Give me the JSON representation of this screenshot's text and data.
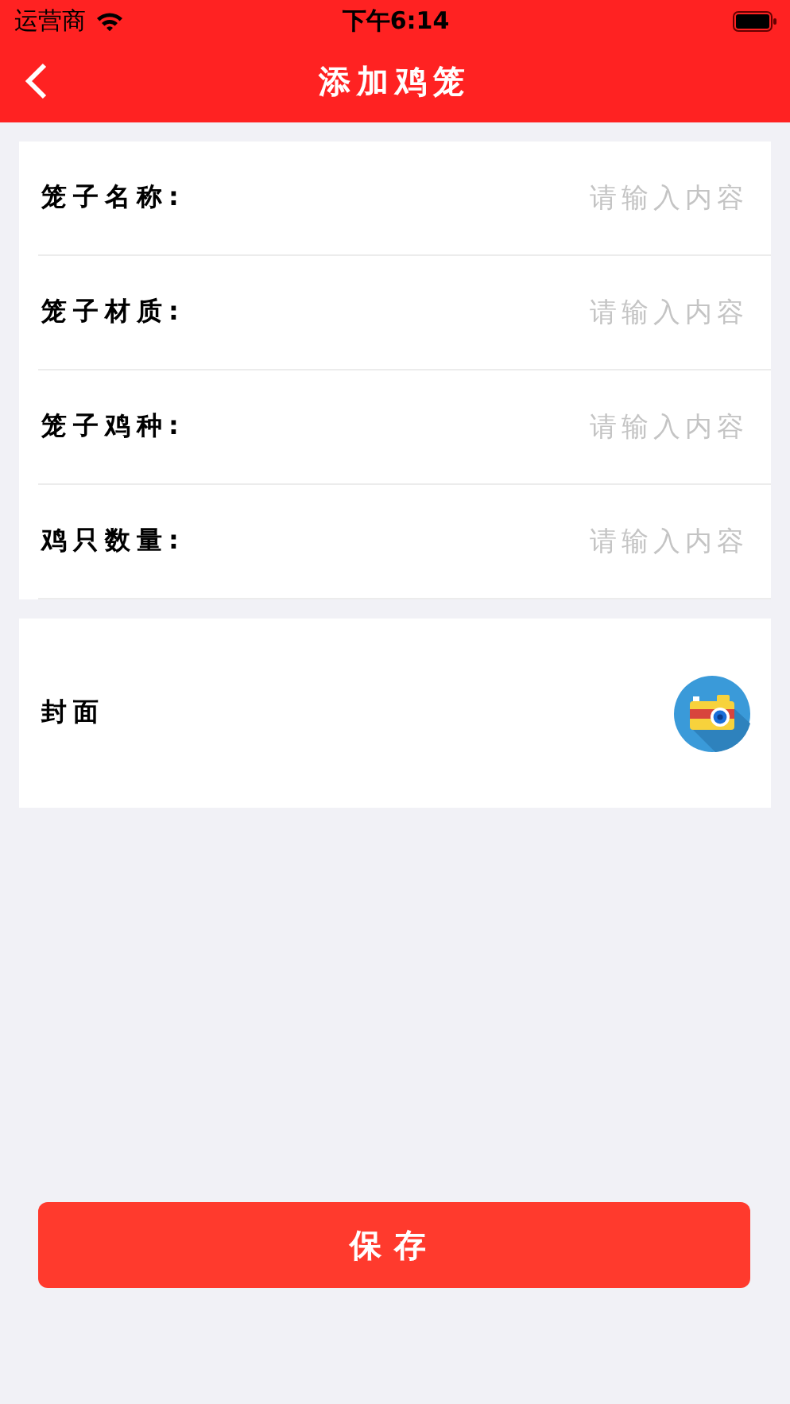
{
  "status_bar": {
    "carrier": "运营商",
    "time": "下午6:14"
  },
  "nav": {
    "title": "添加鸡笼"
  },
  "fields": [
    {
      "label": "笼子名称:",
      "placeholder": "请输入内容"
    },
    {
      "label": "笼子材质:",
      "placeholder": "请输入内容"
    },
    {
      "label": "笼子鸡种:",
      "placeholder": "请输入内容"
    },
    {
      "label": "鸡只数量:",
      "placeholder": "请输入内容"
    }
  ],
  "cover": {
    "label": "封面"
  },
  "save_button": "保存"
}
